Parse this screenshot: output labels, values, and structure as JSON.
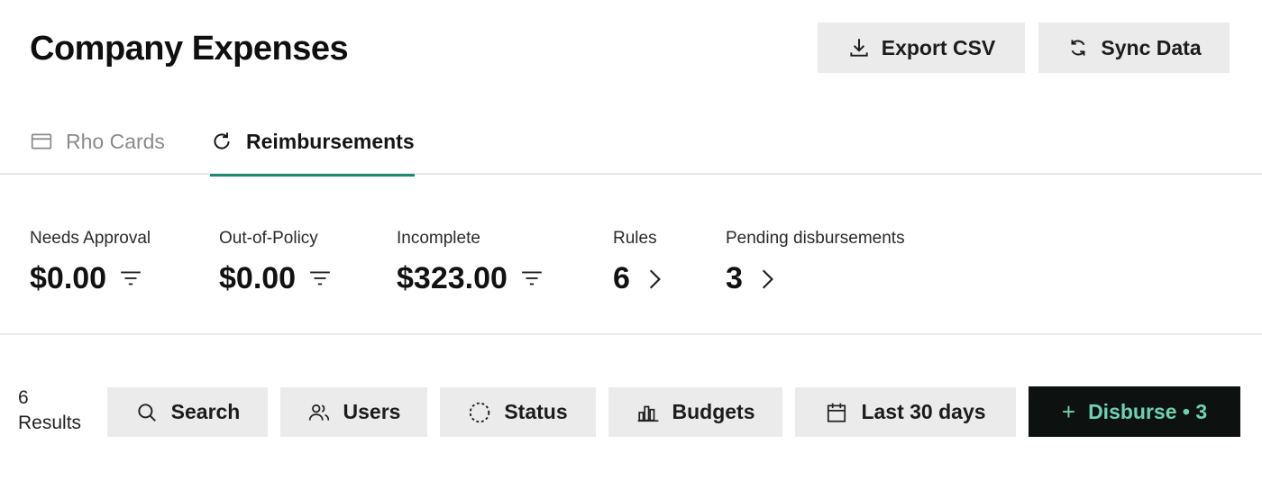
{
  "header": {
    "title": "Company Expenses",
    "export_label": "Export CSV",
    "sync_label": "Sync Data"
  },
  "tabs": [
    {
      "label": "Rho Cards",
      "icon": "card-icon",
      "active": false
    },
    {
      "label": "Reimbursements",
      "icon": "refresh-icon",
      "active": true
    }
  ],
  "metrics": [
    {
      "label": "Needs Approval",
      "value": "$0.00",
      "icon": "filter-icon"
    },
    {
      "label": "Out-of-Policy",
      "value": "$0.00",
      "icon": "filter-icon"
    },
    {
      "label": "Incomplete",
      "value": "$323.00",
      "icon": "filter-icon"
    },
    {
      "label": "Rules",
      "value": "6",
      "icon": "chevron-right-icon"
    },
    {
      "label": "Pending disbursements",
      "value": "3",
      "icon": "chevron-right-icon"
    }
  ],
  "toolbar": {
    "results_count": "6",
    "results_label": "Results",
    "search_label": "Search",
    "users_label": "Users",
    "status_label": "Status",
    "budgets_label": "Budgets",
    "date_label": "Last 30 days",
    "disburse_plus": "+",
    "disburse_label": "Disburse • 3"
  },
  "colors": {
    "accent": "#1e8a72",
    "disburse_bg": "#0d1210",
    "disburse_text": "#6fd0b4",
    "button_bg": "#ebebeb"
  }
}
